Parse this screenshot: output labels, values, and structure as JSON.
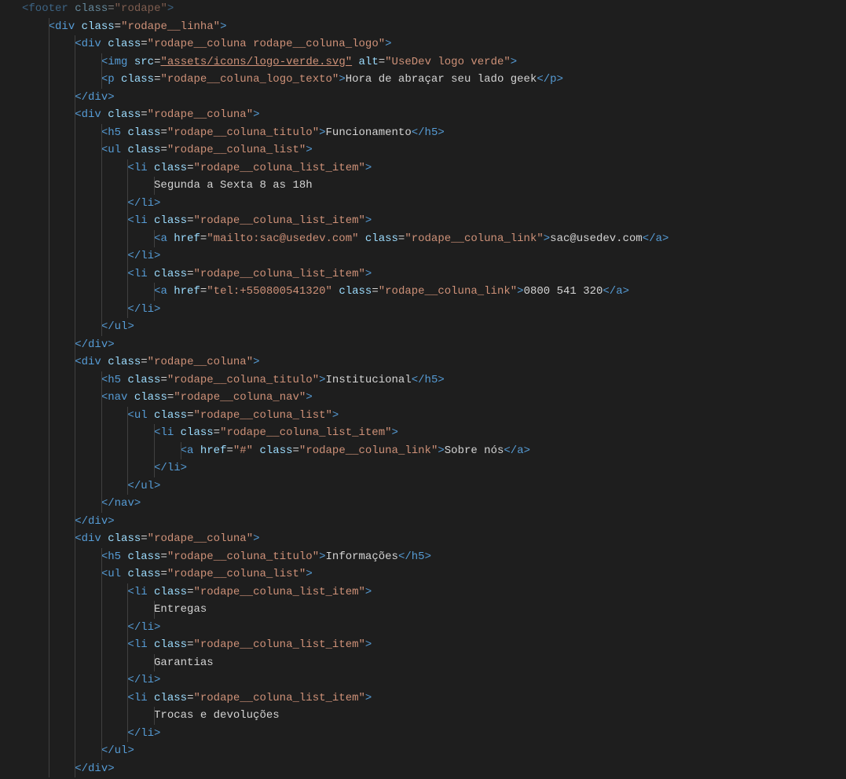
{
  "lines": [
    {
      "indent": 0,
      "type": "open",
      "tag": "footer",
      "attrs": [
        [
          "class",
          "rodape"
        ]
      ],
      "dim": true
    },
    {
      "indent": 1,
      "type": "open",
      "tag": "div",
      "attrs": [
        [
          "class",
          "rodape__linha"
        ]
      ]
    },
    {
      "indent": 2,
      "type": "open",
      "tag": "div",
      "attrs": [
        [
          "class",
          "rodape__coluna rodape__coluna_logo"
        ]
      ]
    },
    {
      "indent": 3,
      "type": "self",
      "tag": "img",
      "attrs": [
        [
          "src",
          "assets/icons/logo-verde.svg",
          "link"
        ],
        [
          "alt",
          "UseDev logo verde"
        ]
      ]
    },
    {
      "indent": 3,
      "type": "inline",
      "tag": "p",
      "attrs": [
        [
          "class",
          "rodape__coluna_logo_texto"
        ]
      ],
      "text": "Hora de abraçar seu lado geek"
    },
    {
      "indent": 2,
      "type": "close",
      "tag": "div"
    },
    {
      "indent": 2,
      "type": "open",
      "tag": "div",
      "attrs": [
        [
          "class",
          "rodape__coluna"
        ]
      ]
    },
    {
      "indent": 3,
      "type": "inline",
      "tag": "h5",
      "attrs": [
        [
          "class",
          "rodape__coluna_titulo"
        ]
      ],
      "text": "Funcionamento"
    },
    {
      "indent": 3,
      "type": "open",
      "tag": "ul",
      "attrs": [
        [
          "class",
          "rodape__coluna_list"
        ]
      ]
    },
    {
      "indent": 4,
      "type": "open",
      "tag": "li",
      "attrs": [
        [
          "class",
          "rodape__coluna_list_item"
        ]
      ]
    },
    {
      "indent": 5,
      "type": "text",
      "text": "Segunda a Sexta 8 as 18h"
    },
    {
      "indent": 4,
      "type": "close",
      "tag": "li"
    },
    {
      "indent": 4,
      "type": "open",
      "tag": "li",
      "attrs": [
        [
          "class",
          "rodape__coluna_list_item"
        ]
      ]
    },
    {
      "indent": 5,
      "type": "inline",
      "tag": "a",
      "attrs": [
        [
          "href",
          "mailto:sac@usedev.com"
        ],
        [
          "class",
          "rodape__coluna_link"
        ]
      ],
      "text": "sac@usedev.com"
    },
    {
      "indent": 4,
      "type": "close",
      "tag": "li"
    },
    {
      "indent": 4,
      "type": "open",
      "tag": "li",
      "attrs": [
        [
          "class",
          "rodape__coluna_list_item"
        ]
      ]
    },
    {
      "indent": 5,
      "type": "inline",
      "tag": "a",
      "attrs": [
        [
          "href",
          "tel:+550800541320"
        ],
        [
          "class",
          "rodape__coluna_link"
        ]
      ],
      "text": "0800 541 320"
    },
    {
      "indent": 4,
      "type": "close",
      "tag": "li"
    },
    {
      "indent": 3,
      "type": "close",
      "tag": "ul"
    },
    {
      "indent": 2,
      "type": "close",
      "tag": "div"
    },
    {
      "indent": 2,
      "type": "open",
      "tag": "div",
      "attrs": [
        [
          "class",
          "rodape__coluna"
        ]
      ]
    },
    {
      "indent": 3,
      "type": "inline",
      "tag": "h5",
      "attrs": [
        [
          "class",
          "rodape__coluna_titulo"
        ]
      ],
      "text": "Institucional"
    },
    {
      "indent": 3,
      "type": "open",
      "tag": "nav",
      "attrs": [
        [
          "class",
          "rodape__coluna_nav"
        ]
      ]
    },
    {
      "indent": 4,
      "type": "open",
      "tag": "ul",
      "attrs": [
        [
          "class",
          "rodape__coluna_list"
        ]
      ]
    },
    {
      "indent": 5,
      "type": "open",
      "tag": "li",
      "attrs": [
        [
          "class",
          "rodape__coluna_list_item"
        ]
      ]
    },
    {
      "indent": 6,
      "type": "inline",
      "tag": "a",
      "attrs": [
        [
          "href",
          "#"
        ],
        [
          "class",
          "rodape__coluna_link"
        ]
      ],
      "text": "Sobre nós"
    },
    {
      "indent": 5,
      "type": "close",
      "tag": "li"
    },
    {
      "indent": 4,
      "type": "close",
      "tag": "ul"
    },
    {
      "indent": 3,
      "type": "close",
      "tag": "nav"
    },
    {
      "indent": 2,
      "type": "close",
      "tag": "div"
    },
    {
      "indent": 2,
      "type": "open",
      "tag": "div",
      "attrs": [
        [
          "class",
          "rodape__coluna"
        ]
      ]
    },
    {
      "indent": 3,
      "type": "inline",
      "tag": "h5",
      "attrs": [
        [
          "class",
          "rodape__coluna_titulo"
        ]
      ],
      "text": "Informações"
    },
    {
      "indent": 3,
      "type": "open",
      "tag": "ul",
      "attrs": [
        [
          "class",
          "rodape__coluna_list"
        ]
      ]
    },
    {
      "indent": 4,
      "type": "open",
      "tag": "li",
      "attrs": [
        [
          "class",
          "rodape__coluna_list_item"
        ]
      ]
    },
    {
      "indent": 5,
      "type": "text",
      "text": "Entregas"
    },
    {
      "indent": 4,
      "type": "close",
      "tag": "li"
    },
    {
      "indent": 4,
      "type": "open",
      "tag": "li",
      "attrs": [
        [
          "class",
          "rodape__coluna_list_item"
        ]
      ]
    },
    {
      "indent": 5,
      "type": "text",
      "text": "Garantias"
    },
    {
      "indent": 4,
      "type": "close",
      "tag": "li"
    },
    {
      "indent": 4,
      "type": "open",
      "tag": "li",
      "attrs": [
        [
          "class",
          "rodape__coluna_list_item"
        ]
      ]
    },
    {
      "indent": 5,
      "type": "text",
      "text": "Trocas e devoluções"
    },
    {
      "indent": 4,
      "type": "close",
      "tag": "li"
    },
    {
      "indent": 3,
      "type": "close",
      "tag": "ul"
    },
    {
      "indent": 2,
      "type": "close",
      "tag": "div"
    }
  ]
}
